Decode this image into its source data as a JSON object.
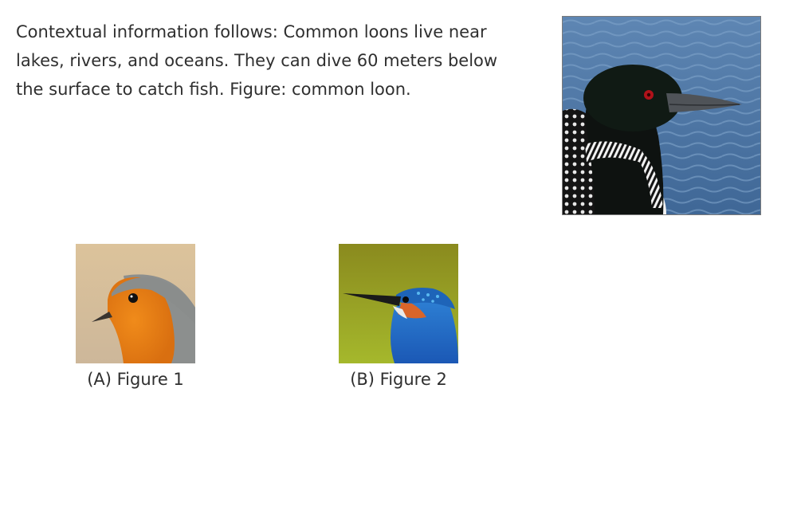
{
  "context": {
    "text": "Contextual information follows: Common loons live near lakes, rivers, and oceans. They can dive 60 meters below the surface to catch fish. Figure: common loon."
  },
  "main_figure": {
    "icon": "common-loon-image"
  },
  "options": [
    {
      "label": "(A) Figure 1",
      "icon": "robin-image"
    },
    {
      "label": "(B) Figure 2",
      "icon": "kingfisher-image"
    }
  ]
}
